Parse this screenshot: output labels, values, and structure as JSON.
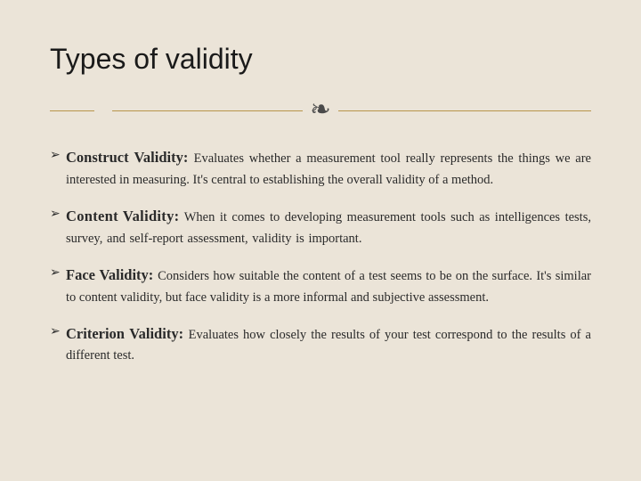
{
  "slide": {
    "title": "Types of validity",
    "flourish": "❧",
    "items": [
      {
        "term": "Construct Validity: ",
        "desc": "Evaluates whether a measurement tool really represents the things we are interested in measuring. It's central to establishing the overall validity of a method."
      },
      {
        "term": "Content Validity: ",
        "desc": "When it comes to developing measurement tools such as intelligences tests, survey, and self-report assessment, validity is important."
      },
      {
        "term": "Face Validity: ",
        "desc": "Considers how suitable the content of a test seems to be on the surface. It's similar to content validity, but face validity is a more informal and subjective assessment."
      },
      {
        "term": "Criterion Validity: ",
        "desc": "Evaluates how closely the results of your test correspond to the results of a different test."
      }
    ]
  }
}
